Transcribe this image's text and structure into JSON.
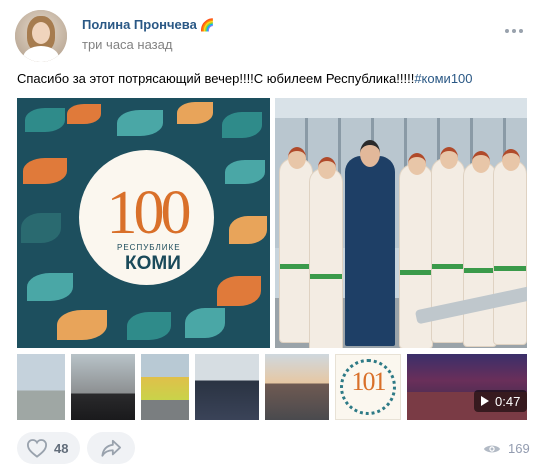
{
  "post": {
    "author": "Полина Прончева",
    "author_emoji": "🌈",
    "time": "три часа назад",
    "text": "Спасибо за этот потрясающий вечер!!!!С юбилеем Республика!!!!!",
    "hashtag": "#коми100",
    "poster": {
      "number": "100",
      "line1": "РЕСПУБЛИКЕ",
      "line2": "КОМИ"
    },
    "thumb_logo_number": "101",
    "video_duration": "0:47",
    "likes": "48",
    "views": "169"
  },
  "colors": {
    "link": "#2a5885",
    "muted": "#828282",
    "button_bg": "#f0f2f5",
    "icon": "#99a2ad",
    "poster_bg": "#1d4f5e",
    "poster_accent": "#d9702a"
  },
  "icons": {
    "more": "more-horizontal-icon",
    "like": "heart-icon",
    "share": "share-icon",
    "views": "eye-icon",
    "play": "play-icon"
  }
}
